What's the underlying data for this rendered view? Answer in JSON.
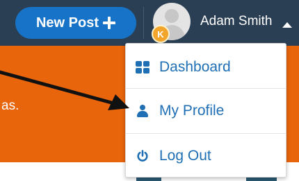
{
  "topbar": {
    "new_post_label": "New Post",
    "user_name": "Adam Smith",
    "avatar_badge_letter": "K"
  },
  "band": {
    "partial_text": "as."
  },
  "menu": {
    "items": [
      {
        "label": "Dashboard",
        "icon": "dashboard-grid-icon"
      },
      {
        "label": "My Profile",
        "icon": "user-icon"
      },
      {
        "label": "Log Out",
        "icon": "power-icon"
      }
    ]
  },
  "colors": {
    "topbar": "#2b3f54",
    "accent_blue": "#1773c7",
    "menu_text": "#1f6fb5",
    "orange_band": "#e8650b",
    "annotation_arrow": "#111111"
  }
}
